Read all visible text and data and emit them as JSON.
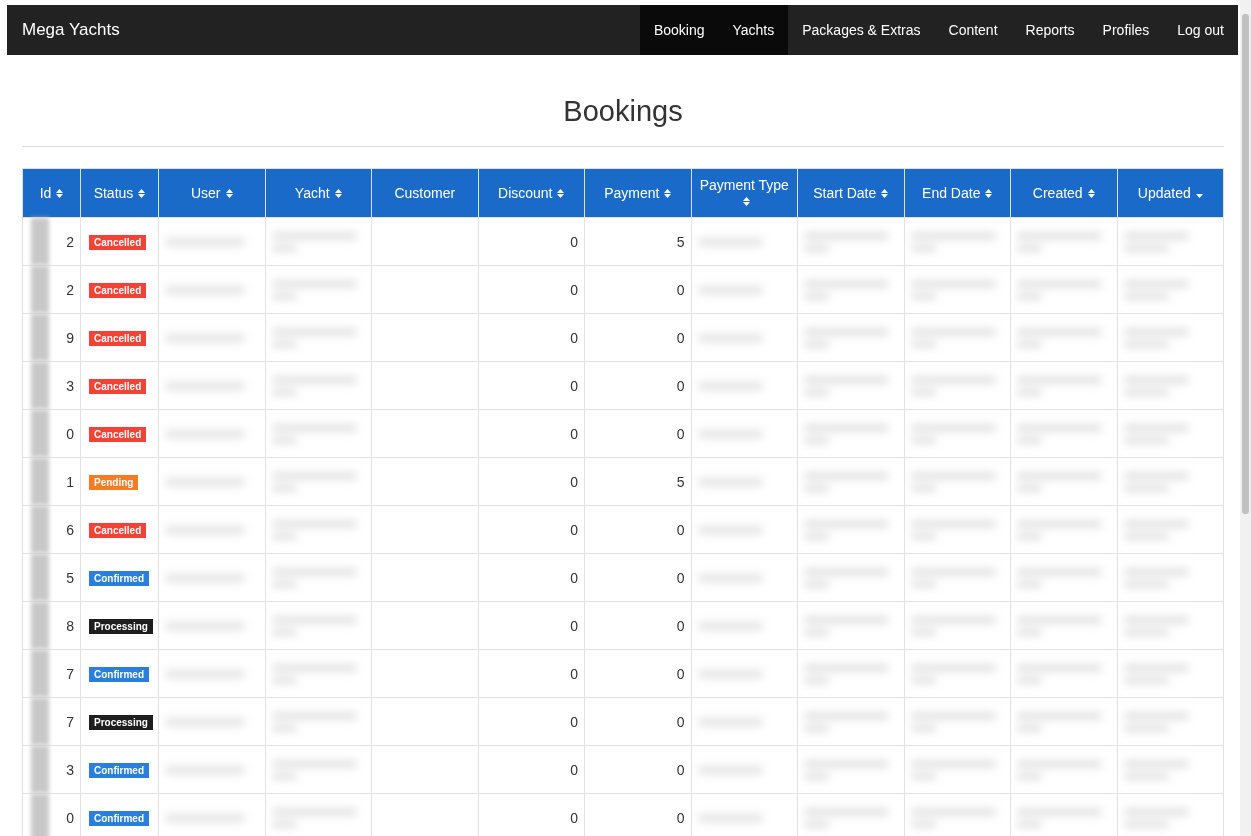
{
  "navbar": {
    "brand": "Mega Yachts",
    "items": [
      {
        "label": "Booking",
        "selected": true
      },
      {
        "label": "Yachts",
        "selected": true
      },
      {
        "label": "Packages & Extras",
        "selected": false
      },
      {
        "label": "Content",
        "selected": false
      },
      {
        "label": "Reports",
        "selected": false
      },
      {
        "label": "Profiles",
        "selected": false
      },
      {
        "label": "Log out",
        "selected": false
      }
    ]
  },
  "title": "Bookings",
  "table": {
    "columns": [
      {
        "label": "Id",
        "sortable": true
      },
      {
        "label": "Status",
        "sortable": true
      },
      {
        "label": "User",
        "sortable": true
      },
      {
        "label": "Yacht",
        "sortable": true
      },
      {
        "label": "Customer",
        "sortable": false
      },
      {
        "label": "Discount",
        "sortable": true
      },
      {
        "label": "Payment",
        "sortable": true
      },
      {
        "label": "Payment Type",
        "sortable": true
      },
      {
        "label": "Start Date",
        "sortable": true
      },
      {
        "label": "End Date",
        "sortable": true
      },
      {
        "label": "Created",
        "sortable": true
      },
      {
        "label": "Updated",
        "sortable": true,
        "sorted_descending": true
      }
    ],
    "rows": [
      {
        "id": "2",
        "status": "Cancelled",
        "color": "#f44336",
        "discount": "0",
        "payment": "5"
      },
      {
        "id": "2",
        "status": "Cancelled",
        "color": "#f44336",
        "discount": "0",
        "payment": "0"
      },
      {
        "id": "9",
        "status": "Cancelled",
        "color": "#f44336",
        "discount": "0",
        "payment": "0"
      },
      {
        "id": "3",
        "status": "Cancelled",
        "color": "#f44336",
        "discount": "0",
        "payment": "0"
      },
      {
        "id": "0",
        "status": "Cancelled",
        "color": "#f44336",
        "discount": "0",
        "payment": "0"
      },
      {
        "id": "1",
        "status": "Pending",
        "color": "#f57c25",
        "discount": "0",
        "payment": "5"
      },
      {
        "id": "6",
        "status": "Cancelled",
        "color": "#f44336",
        "discount": "0",
        "payment": "0"
      },
      {
        "id": "5",
        "status": "Confirmed",
        "color": "#2a7fde",
        "discount": "0",
        "payment": "0"
      },
      {
        "id": "8",
        "status": "Processing",
        "color": "#1e1e1e",
        "discount": "0",
        "payment": "0"
      },
      {
        "id": "7",
        "status": "Confirmed",
        "color": "#2a7fde",
        "discount": "0",
        "payment": "0"
      },
      {
        "id": "7",
        "status": "Processing",
        "color": "#1e1e1e",
        "discount": "0",
        "payment": "0"
      },
      {
        "id": "3",
        "status": "Confirmed",
        "color": "#2a7fde",
        "discount": "0",
        "payment": "0"
      },
      {
        "id": "0",
        "status": "Confirmed",
        "color": "#2a7fde",
        "discount": "0",
        "payment": "0"
      }
    ]
  }
}
